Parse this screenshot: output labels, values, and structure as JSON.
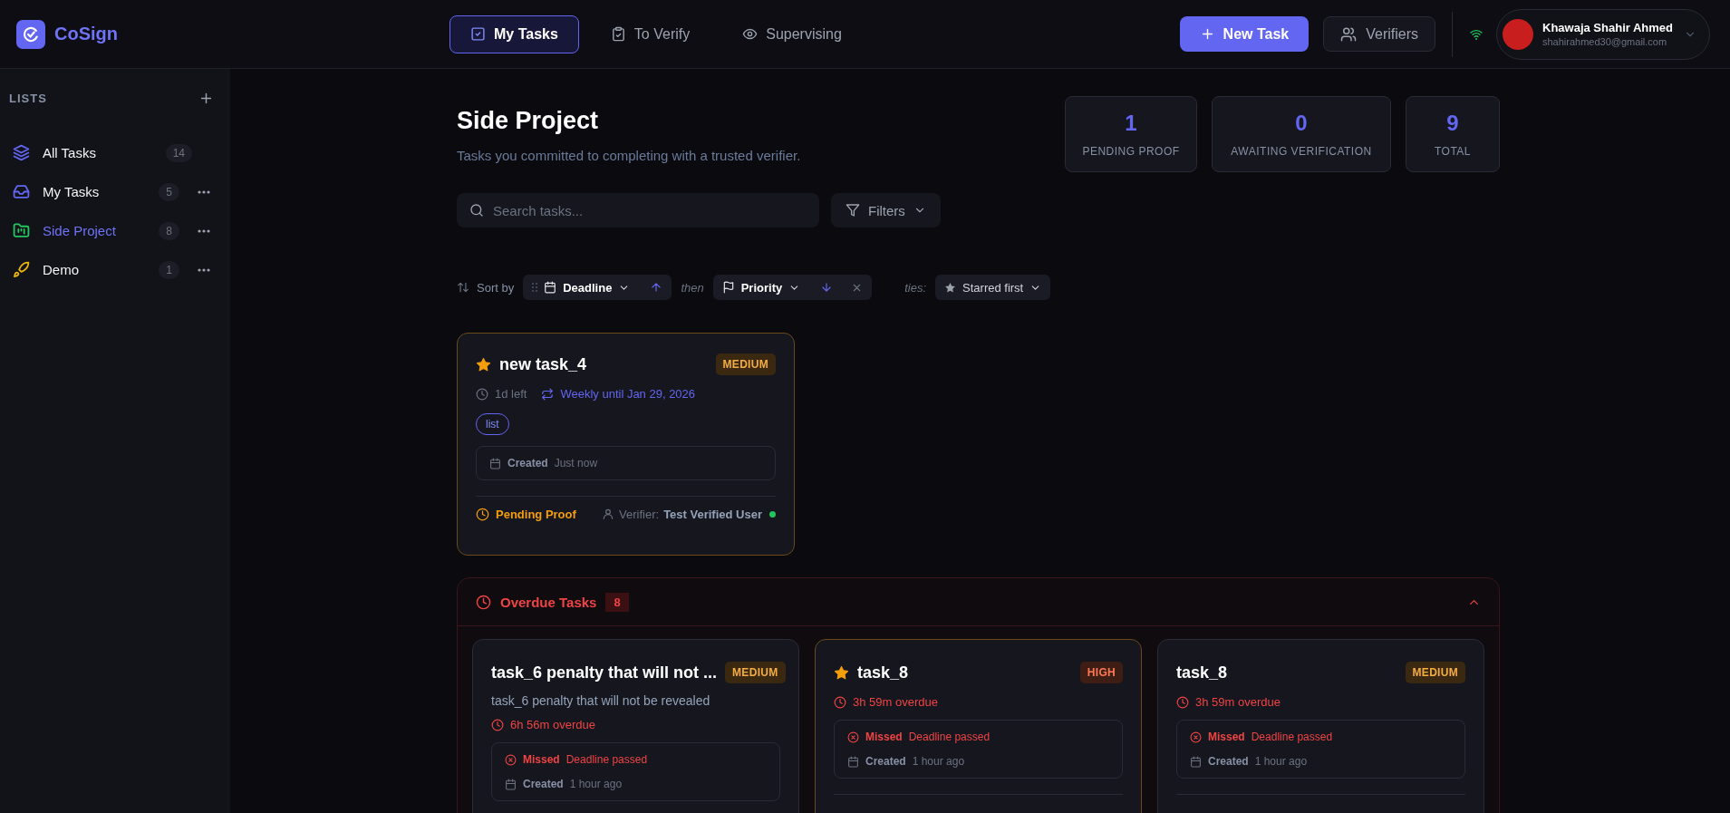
{
  "brand": {
    "name": "CoSign"
  },
  "nav_tabs": [
    {
      "label": "My Tasks",
      "kind": "mine",
      "selected": true
    },
    {
      "label": "To Verify",
      "kind": "verify",
      "selected": false
    },
    {
      "label": "Supervising",
      "kind": "supervise",
      "selected": false
    }
  ],
  "actions": {
    "new_task": "New Task",
    "verifiers": "Verifiers"
  },
  "connected": true,
  "user": {
    "name": "Khawaja Shahir Ahmed",
    "email": "shahirahmed30@gmail.com"
  },
  "sidebar": {
    "heading": "LISTS",
    "items": [
      {
        "label": "All Tasks",
        "count": "14",
        "kind": "all",
        "color": "#6366f1",
        "selected": false,
        "menu": false
      },
      {
        "label": "My Tasks",
        "count": "5",
        "kind": "inbox",
        "color": "#6366f1",
        "selected": false,
        "menu": true
      },
      {
        "label": "Side Project",
        "count": "8",
        "kind": "project",
        "color": "#22c55e",
        "selected": true,
        "menu": true
      },
      {
        "label": "Demo",
        "count": "1",
        "kind": "launch",
        "color": "#eab308",
        "selected": false,
        "menu": true
      }
    ]
  },
  "page": {
    "title": "Side Project",
    "subtitle": "Tasks you committed to completing with a trusted verifier."
  },
  "stats": [
    {
      "value": "1",
      "label": "PENDING PROOF"
    },
    {
      "value": "0",
      "label": "AWAITING VERIFICATION"
    },
    {
      "value": "9",
      "label": "TOTAL"
    }
  ],
  "search": {
    "placeholder": "Search tasks..."
  },
  "filters_button": "Filters",
  "sort": {
    "label": "Sort by",
    "keys": [
      {
        "field": "Deadline",
        "kind": "date",
        "ascending": true,
        "removable": false
      },
      {
        "field": "Priority",
        "kind": "priority",
        "ascending": false,
        "removable": true
      }
    ],
    "then": "then",
    "ties_label": "ties:",
    "ties": "Starred first"
  },
  "tasks": [
    {
      "title": "new task_4",
      "starred": true,
      "priority": {
        "text": "MEDIUM",
        "color": "#3a2910"
      },
      "time_left": "1d left",
      "recurrence": "Weekly until Jan 29, 2026",
      "tags": [
        "list"
      ],
      "created_label": "Created",
      "created": "Just now",
      "status": "Pending Proof",
      "verifier_label": "Verifier:",
      "verifier": "Test Verified User",
      "verifier_online": true
    }
  ],
  "overdue": {
    "title": "Overdue Tasks",
    "count": "8",
    "expanded": true,
    "tasks": [
      {
        "title": "task_6 penalty that will not ...",
        "starred": false,
        "priority": {
          "text": "MEDIUM",
          "color": "#3a2910"
        },
        "description": "task_6 penalty that will not be revealed",
        "overdue": "6h 56m overdue",
        "missed_label": "Missed",
        "missed_reason": "Deadline passed",
        "created_label": "Created",
        "created": "1 hour ago"
      },
      {
        "title": "task_8",
        "starred": true,
        "priority": {
          "text": "HIGH",
          "color": "#3d1d14"
        },
        "overdue": "3h 59m overdue",
        "missed_label": "Missed",
        "missed_reason": "Deadline passed",
        "created_label": "Created",
        "created": "1 hour ago"
      },
      {
        "title": "task_8",
        "starred": false,
        "priority": {
          "text": "MEDIUM",
          "color": "#3a2910"
        },
        "overdue": "3h 59m overdue",
        "missed_label": "Missed",
        "missed_reason": "Deadline passed",
        "created_label": "Created",
        "created": "1 hour ago"
      }
    ]
  }
}
